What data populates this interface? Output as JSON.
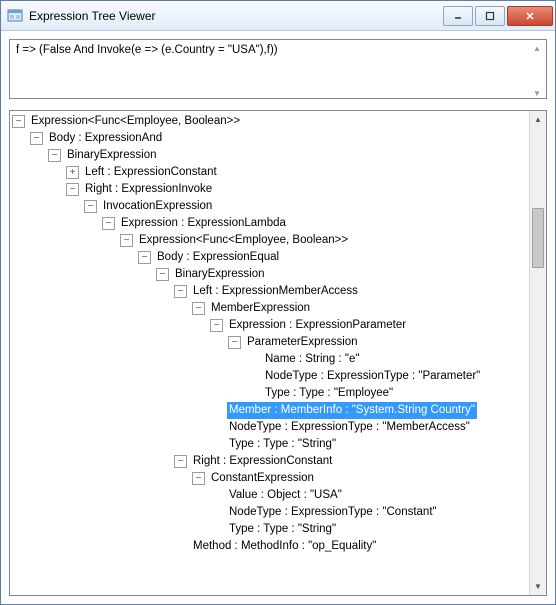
{
  "window": {
    "title": "Expression Tree Viewer"
  },
  "expression_text": "f => (False And Invoke(e => (e.Country = \"USA\"),f))",
  "tree": {
    "n0": "Expression<Func<Employee, Boolean>>",
    "n1": "Body : ExpressionAnd",
    "n2": "BinaryExpression",
    "n3": "Left : ExpressionConstant",
    "n4": "Right : ExpressionInvoke",
    "n5": "InvocationExpression",
    "n6": "Expression : ExpressionLambda",
    "n7": "Expression<Func<Employee, Boolean>>",
    "n8": "Body : ExpressionEqual",
    "n9": "BinaryExpression",
    "n10": "Left : ExpressionMemberAccess",
    "n11": "MemberExpression",
    "n12": "Expression : ExpressionParameter",
    "n13": "ParameterExpression",
    "n14": "Name : String : \"e\"",
    "n15": "NodeType : ExpressionType : \"Parameter\"",
    "n16": "Type : Type : \"Employee\"",
    "n17": "Member : MemberInfo : \"System.String Country\"",
    "n18": "NodeType : ExpressionType : \"MemberAccess\"",
    "n19": "Type : Type : \"String\"",
    "n20": "Right : ExpressionConstant",
    "n21": "ConstantExpression",
    "n22": "Value : Object : \"USA\"",
    "n23": "NodeType : ExpressionType : \"Constant\"",
    "n24": "Type : Type : \"String\"",
    "n25": "Method : MethodInfo : \"op_Equality\""
  },
  "selected": "n17",
  "icons": {
    "minus": "−",
    "plus": "+"
  }
}
